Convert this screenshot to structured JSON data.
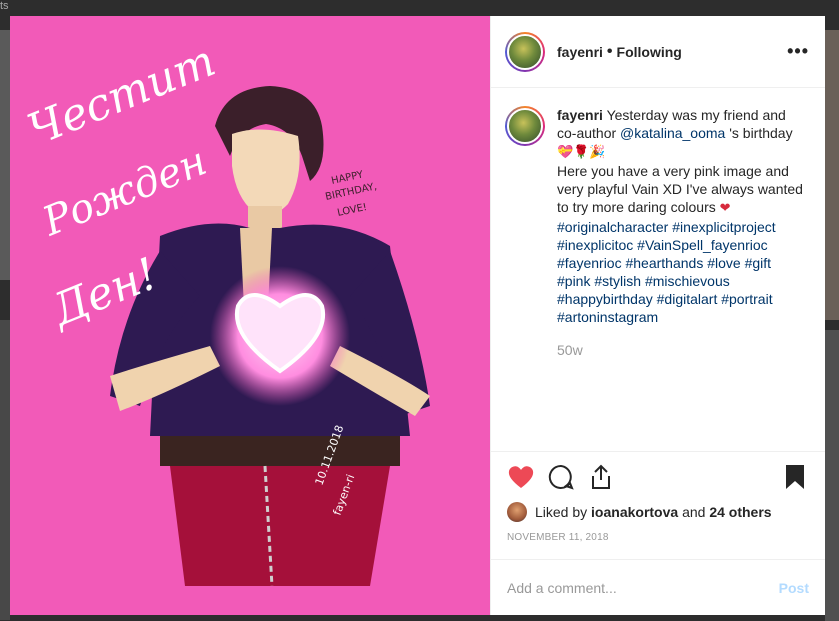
{
  "background": {
    "corner_text": "ts"
  },
  "post": {
    "username": "fayenri",
    "follow_status": "Following",
    "caption": {
      "line1": "Yesterday was my friend and co-author",
      "mention": "@katalina_ooma",
      "line1_end": "'s birthday",
      "emojis": "💝🌹🎉",
      "line2": "Here you have a very pink image and very playful Vain XD I've always wanted to try more daring colours",
      "heart": "❤",
      "hashtags": [
        "#originalcharacter",
        "#inexplicitproject",
        "#inexplicitoc",
        "#VainSpell_fayenrioc",
        "#fayenrioc",
        "#hearthands",
        "#love",
        "#gift",
        "#pink",
        "#stylish",
        "#mischievous",
        "#happybirthday",
        "#digitalart",
        "#portrait",
        "#artoninstagram"
      ]
    },
    "time_ago": "50w",
    "likes": {
      "prefix": "Liked by",
      "user": "ioanakortova",
      "and": "and",
      "others": "24 others"
    },
    "date": "NOVEMBER 11, 2018",
    "comment_placeholder": "Add a comment...",
    "post_label": "Post"
  },
  "artwork": {
    "handwriting": [
      "Честит",
      "Рожден",
      "Ден!"
    ],
    "speech": [
      "HAPPY",
      "BIRTHDAY,",
      "LOVE!"
    ],
    "signature": [
      "10.11.2018",
      "fayen-ri"
    ]
  },
  "colors": {
    "pink_bg": "#f25ab8",
    "like_red": "#ed4956",
    "link": "#003569",
    "post_disabled": "#b3dbff"
  },
  "icons": [
    "more-options-icon",
    "heart-icon",
    "comment-icon",
    "share-icon",
    "bookmark-icon"
  ]
}
